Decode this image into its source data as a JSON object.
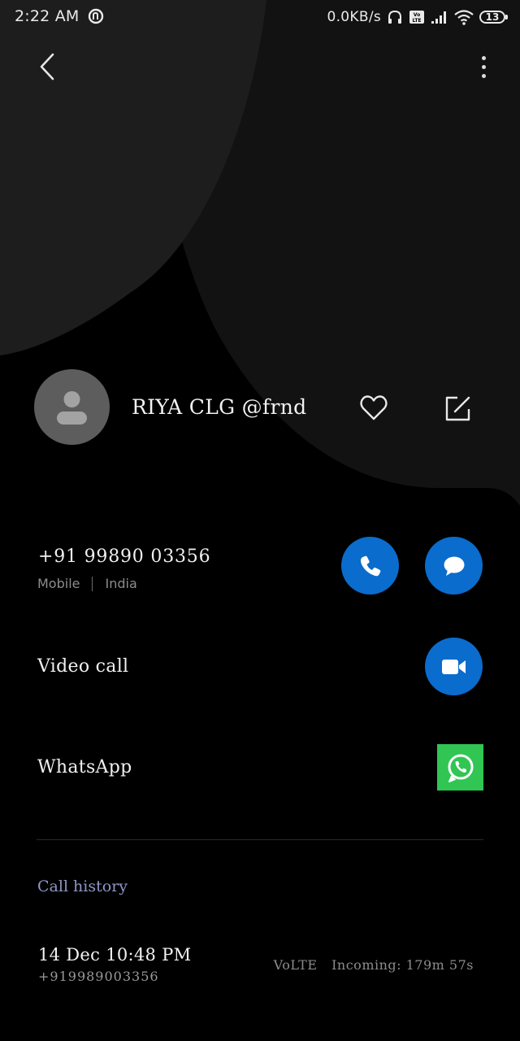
{
  "status_bar": {
    "time": "2:22 AM",
    "network_speed": "0.0KB/s",
    "battery_level": "13",
    "icons": [
      "sync-icon",
      "headphones-icon",
      "volte-icon",
      "signal-icon",
      "wifi-icon",
      "battery-icon"
    ]
  },
  "top_bar": {
    "icons": [
      "back-chevron-icon",
      "more-vert-icon"
    ]
  },
  "contact": {
    "name": "RIYA CLG @frnd",
    "icons": [
      "person-avatar-icon",
      "heart-outline-icon",
      "edit-icon"
    ]
  },
  "phone": {
    "number": "+91 99890 03356",
    "type": "Mobile",
    "location": "India",
    "icons": [
      "phone-icon",
      "message-icon"
    ]
  },
  "video_call": {
    "label": "Video call",
    "icon": "video-camera-icon"
  },
  "whatsapp": {
    "label": "WhatsApp",
    "icon": "whatsapp-icon"
  },
  "call_history": {
    "title": "Call history",
    "entries": [
      {
        "datetime": "14 Dec 10:48 PM",
        "number": "+919989003356",
        "network": "VoLTE",
        "detail": "Incoming: 179m 57s"
      }
    ]
  },
  "colors": {
    "background": "#000000",
    "shape_dark": "#1c1c1c",
    "shape_mid": "#141414",
    "action_blue": "#0a6ccd",
    "whatsapp_green": "#31c553",
    "section_title": "#8f97c6",
    "avatar_gray": "#5d5d5d"
  }
}
